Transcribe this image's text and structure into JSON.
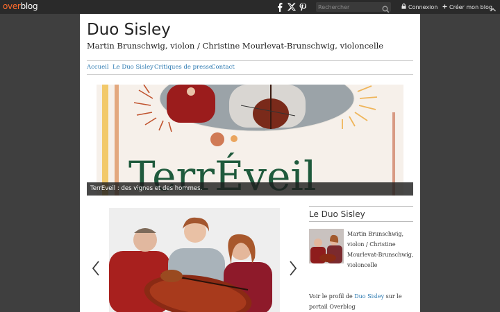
{
  "topbar": {
    "logo_over": "over",
    "logo_blog": "blog",
    "search_placeholder": "Rechercher",
    "login_label": "Connexion",
    "create_label": "Créer mon blog"
  },
  "site": {
    "title": "Duo Sisley",
    "subtitle": "Martin Brunschwig, violon / Christine Mourlevat-Brunschwig, violoncelle"
  },
  "nav": {
    "items": [
      "Accueil",
      "Le Duo Sisley",
      "Critiques de presse",
      "Contact"
    ]
  },
  "banner": {
    "image_text": "TerrÉveil",
    "caption": "TerrEveil : des vignes et des hommes."
  },
  "sidebar": {
    "title": "Le Duo Sisley",
    "description": "Martin Brunschwig, violon / Christine Mourlevat-Brunschwig, violoncelle",
    "profile_prefix": "Voir le profil de",
    "profile_link": "Duo Sisley",
    "profile_suffix": "sur le portail Overblog"
  },
  "colors": {
    "accent_link": "#2a78b0",
    "banner_green": "#1f5a3c",
    "brand_orange": "#ff6c2c"
  },
  "icons": [
    "facebook-icon",
    "x-icon",
    "pinterest-icon",
    "search-icon",
    "lock-icon",
    "plus-icon",
    "chevron-up-icon",
    "chevron-left-icon",
    "chevron-right-icon"
  ]
}
